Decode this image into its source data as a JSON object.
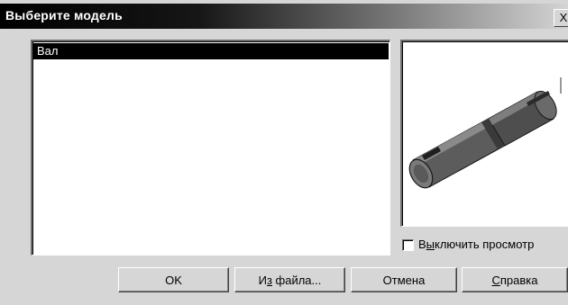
{
  "window": {
    "title": "Выберите модель",
    "close_glyph": "X"
  },
  "model_list": {
    "items": [
      {
        "label": "Вал",
        "selected": true
      }
    ]
  },
  "preview": {
    "icon": "shaft-3d-preview"
  },
  "disable_preview": {
    "label_pre": "В",
    "label_mnemonic": "ы",
    "label_post": "ключить просмотр",
    "checked": false
  },
  "buttons": {
    "ok": "OK",
    "from_file_pre": "И",
    "from_file_mnemonic": "з",
    "from_file_post": " файла...",
    "cancel": "Отмена",
    "help_pre": "",
    "help_mnemonic": "С",
    "help_post": "правка"
  }
}
